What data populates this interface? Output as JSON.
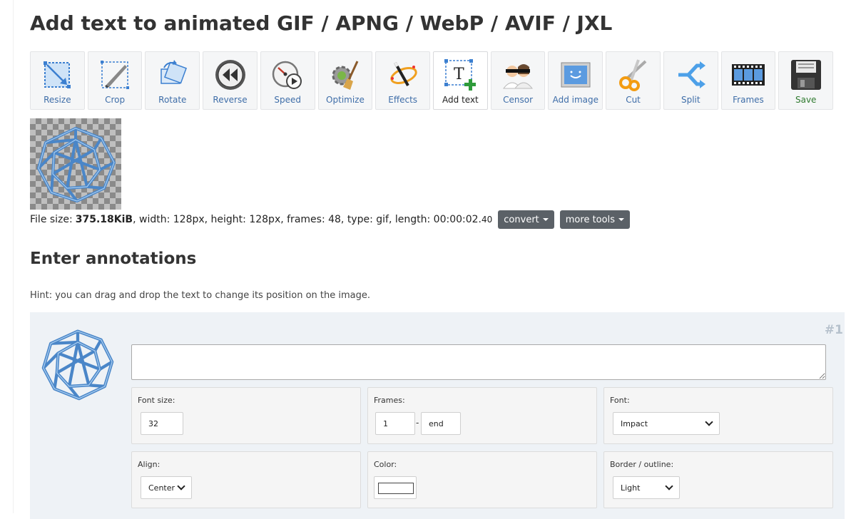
{
  "page_title": "Add text to animated GIF / APNG / WebP / AVIF / JXL",
  "toolbar": [
    {
      "label": "Resize",
      "icon": "resize-icon"
    },
    {
      "label": "Crop",
      "icon": "crop-icon"
    },
    {
      "label": "Rotate",
      "icon": "rotate-icon"
    },
    {
      "label": "Reverse",
      "icon": "reverse-icon"
    },
    {
      "label": "Speed",
      "icon": "speed-icon"
    },
    {
      "label": "Optimize",
      "icon": "optimize-icon"
    },
    {
      "label": "Effects",
      "icon": "effects-icon"
    },
    {
      "label": "Add text",
      "icon": "add-text-icon",
      "active": true
    },
    {
      "label": "Censor",
      "icon": "censor-icon"
    },
    {
      "label": "Add image",
      "icon": "add-image-icon"
    },
    {
      "label": "Cut",
      "icon": "cut-icon"
    },
    {
      "label": "Split",
      "icon": "split-icon"
    },
    {
      "label": "Frames",
      "icon": "frames-icon"
    },
    {
      "label": "Save",
      "icon": "save-icon"
    }
  ],
  "file_info": {
    "size_label": "File size:",
    "size_value": "375.18KiB",
    "details": ", width: 128px, height: 128px, frames: 48, type: gif, length: 00:00:02.",
    "length_fraction": "40",
    "convert_label": "convert",
    "more_tools_label": "more tools"
  },
  "annotations": {
    "heading": "Enter annotations",
    "hint": "Hint: you can drag and drop the text to change its position on the image.",
    "item_number": "#1",
    "text_value": "",
    "font_size": {
      "label": "Font size:",
      "value": "32"
    },
    "frames": {
      "label": "Frames:",
      "from": "1",
      "separator": "-",
      "to": "end"
    },
    "font": {
      "label": "Font:",
      "value": "Impact"
    },
    "align": {
      "label": "Align:",
      "value": "Center"
    },
    "color": {
      "label": "Color:",
      "value": "#ffffff"
    },
    "border": {
      "label": "Border / outline:",
      "value": "Light"
    }
  },
  "colors": {
    "tool_label": "#3e6da8",
    "save_label": "#2f7a2f",
    "dropdown_bg": "#5b6167",
    "panel_bg": "#eef2f6",
    "sphere_blue": "#4a86c8"
  }
}
